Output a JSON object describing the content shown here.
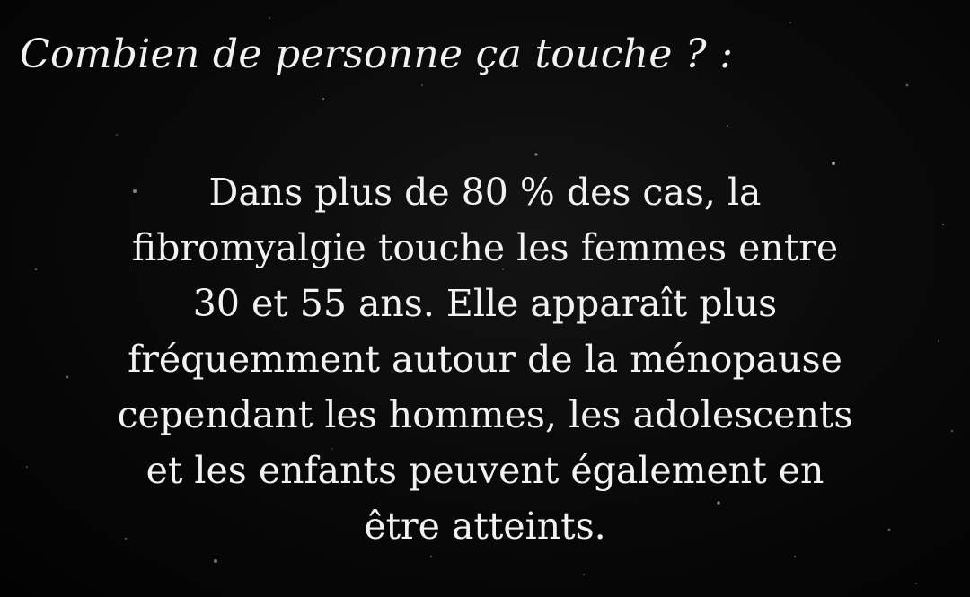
{
  "heading": "Combien de personne ça touche ? :",
  "paragraph_lines": [
    "Dans plus de 80 % des cas, la",
    "fibromyalgie touche les femmes entre",
    "30 et 55 ans. Elle apparaît plus",
    "fréquemment autour de la ménopause",
    "cependant les hommes, les adolescents",
    "et les enfants peuvent également en",
    "être atteints."
  ],
  "colors": {
    "background": "#050505",
    "text": "#f2f2f2"
  }
}
